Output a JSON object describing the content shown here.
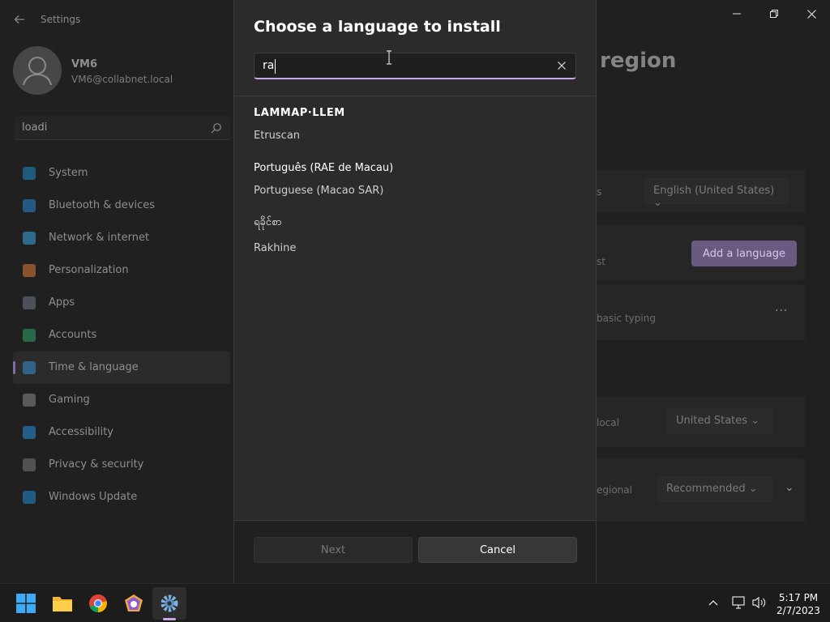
{
  "settings": {
    "app_title": "Settings",
    "user": {
      "name": "VM6",
      "email": "VM6@collabnet.local"
    },
    "find_setting_value": "loadi",
    "nav": [
      {
        "label": "System",
        "icon": "monitor-icon",
        "color": "#1f8cc9"
      },
      {
        "label": "Bluetooth & devices",
        "icon": "bluetooth-icon",
        "color": "#2a86d6"
      },
      {
        "label": "Network & internet",
        "icon": "wifi-icon",
        "color": "#3aa7e0"
      },
      {
        "label": "Personalization",
        "icon": "brush-icon",
        "color": "#e07b3a"
      },
      {
        "label": "Apps",
        "icon": "apps-icon",
        "color": "#6f7a8a"
      },
      {
        "label": "Accounts",
        "icon": "person-icon",
        "color": "#2fa36b"
      },
      {
        "label": "Time & language",
        "icon": "globe-clock-icon",
        "color": "#3b8fd6"
      },
      {
        "label": "Gaming",
        "icon": "gamepad-icon",
        "color": "#8a8a8a"
      },
      {
        "label": "Accessibility",
        "icon": "accessibility-icon",
        "color": "#2a8fe0"
      },
      {
        "label": "Privacy & security",
        "icon": "shield-icon",
        "color": "#7a7a7a"
      },
      {
        "label": "Windows Update",
        "icon": "update-icon",
        "color": "#1f8cd6"
      }
    ],
    "selected_nav": "Time & language",
    "main": {
      "title_visible": "region",
      "display_language_label": "s",
      "display_language_value": "English (United States)",
      "preferred_label": "st",
      "add_language_label": "Add a language",
      "lang_card_text": "basic typing",
      "country_label": "local",
      "country_value": "United States",
      "format_label": "egional",
      "format_value": "Recommended"
    }
  },
  "dialog": {
    "title": "Choose a language to install",
    "search_value": "ra",
    "results": [
      {
        "native": "𐌀𐌓𐌀𐌐𐌀-𐌋𐌉𐌔𐌄",
        "native_display": "LAMMAP·LLEM",
        "english": "Etruscan"
      },
      {
        "native": "Português (RAE de Macau)",
        "english": "Portuguese (Macao SAR)"
      },
      {
        "native": "ရခိုင်စာ",
        "english": "Rakhine"
      }
    ],
    "next_label": "Next",
    "cancel_label": "Cancel"
  },
  "taskbar": {
    "apps": [
      "start-icon",
      "file-explorer-icon",
      "chrome-icon",
      "app-icon",
      "settings-icon"
    ],
    "time": "5:17 PM",
    "date": "2/7/2023"
  }
}
